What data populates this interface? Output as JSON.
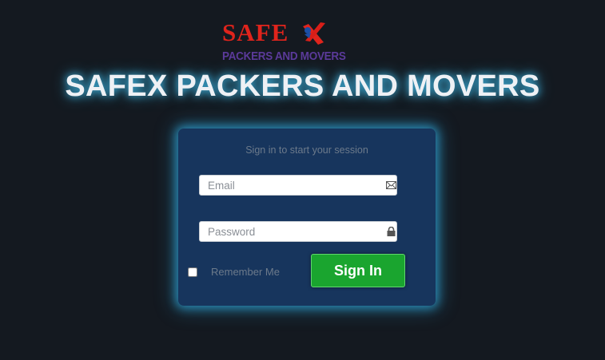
{
  "logo": {
    "word": "SAFE",
    "tagline": "PACKERS AND MOVERS",
    "brand_red": "#e0241c",
    "brand_purple": "#5b3a9a"
  },
  "header": {
    "title": "SAFEX PACKERS AND MOVERS"
  },
  "login": {
    "session_message": "Sign in to start your session",
    "email": {
      "placeholder": "Email",
      "value": "",
      "icon": "envelope-icon"
    },
    "password": {
      "placeholder": "Password",
      "value": "",
      "icon": "lock-icon"
    },
    "remember_me": {
      "label": "Remember Me",
      "checked": false
    },
    "submit_label": "Sign In"
  },
  "colors": {
    "background": "#141920",
    "panel": "#17355d",
    "glow": "#2fa3d6",
    "button": "#1aa52f"
  }
}
